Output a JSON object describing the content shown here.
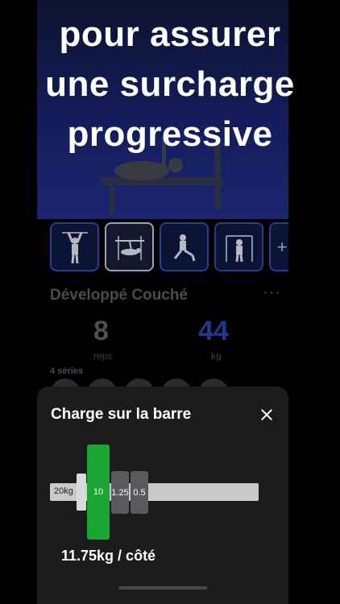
{
  "headline": {
    "line1": "pour assurer",
    "line2": "une surcharge",
    "line3": "progressive"
  },
  "exercise": {
    "name": "Développé Couché",
    "menu": "···",
    "reps_value": "8",
    "reps_label": "reps",
    "kg_value": "44",
    "kg_label": "kg",
    "series_label": "4 séries"
  },
  "thumbnails": [
    {
      "icon": "pull-up-figure"
    },
    {
      "icon": "bench-press-figure",
      "selected": true
    },
    {
      "icon": "lunge-figure"
    },
    {
      "icon": "cable-row-figure"
    },
    {
      "icon": "plus-icon",
      "more": true
    }
  ],
  "sheet": {
    "title": "Charge sur la barre",
    "bar_weight": "20kg",
    "plates": [
      "10",
      "1.25",
      "0.5"
    ],
    "per_side": "11.75kg / côté"
  },
  "colors": {
    "background": "#000000",
    "sheet": "#1c1c1e",
    "plate_primary": "#1aa534",
    "plate_small": "#5a5a5e",
    "accent_blue": "#1f3a8e"
  }
}
